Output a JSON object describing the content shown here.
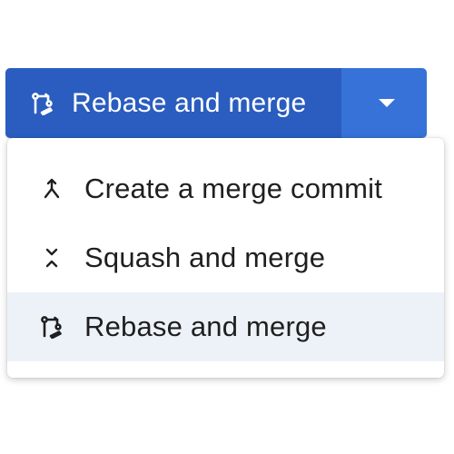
{
  "split_button": {
    "label": "Rebase and merge",
    "icon": "rebase-icon",
    "toggle_icon": "caret-down-icon",
    "main_color": "#2a5dbf",
    "toggle_color": "#3672d8"
  },
  "menu": {
    "items": [
      {
        "label": "Create a merge commit",
        "icon": "merge-commit-icon",
        "selected": false
      },
      {
        "label": "Squash and merge",
        "icon": "squash-icon",
        "selected": false
      },
      {
        "label": "Rebase and merge",
        "icon": "rebase-icon",
        "selected": true
      }
    ],
    "selected_background": "#edf2f9"
  }
}
